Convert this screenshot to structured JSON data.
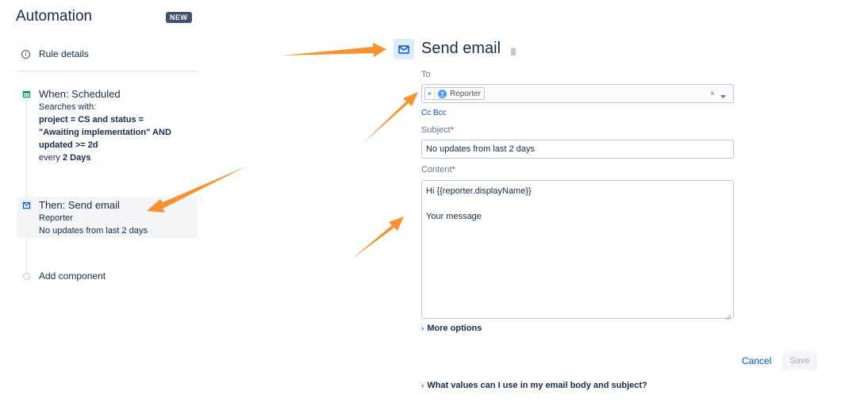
{
  "header": {
    "title": "Automation",
    "badge": "NEW"
  },
  "sidebar": {
    "rule_details": "Rule details",
    "trigger": {
      "title": "When: Scheduled",
      "searches_with": "Searches with:",
      "query_lines": [
        "project = CS and status =",
        "\"Awaiting implementation\" AND",
        "updated >= 2d"
      ],
      "every_prefix": "every",
      "every_value": "2 Days",
      "icon": "calendar-icon"
    },
    "action": {
      "title": "Then: Send email",
      "recipient": "Reporter",
      "subject": "No updates from last 2 days",
      "icon": "mail-icon"
    },
    "add_component": "Add component"
  },
  "main": {
    "title": "Send email",
    "to_label": "To",
    "to_chip": "Reporter",
    "cc_bcc": "Cc Bcc",
    "subject_label": "Subject",
    "subject_value": "No updates from last 2 days",
    "content_label": "Content",
    "content_value": "Hi {{reporter.displayName}}\n\nYour message",
    "more_options": "More options",
    "cancel": "Cancel",
    "save": "Save",
    "help_link": "What values can I use in my email body and subject?"
  },
  "colors": {
    "accent": "#0052cc",
    "arrow": "#f79232",
    "required": "#de350b"
  }
}
